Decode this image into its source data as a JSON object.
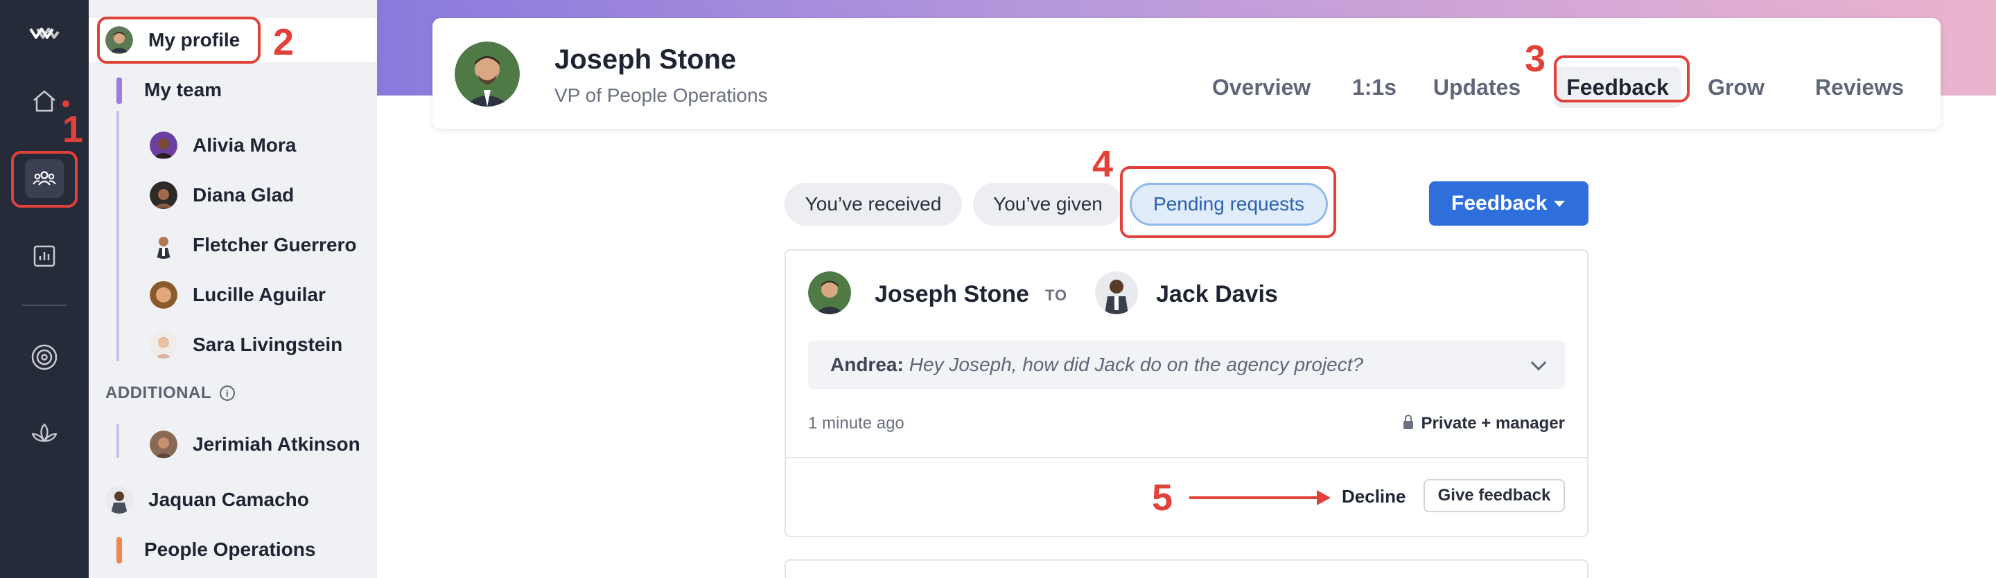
{
  "sidebar": {
    "my_profile": "My profile",
    "my_team": "My team",
    "team_members": [
      "Alivia Mora",
      "Diana Glad",
      "Fletcher Guerrero",
      "Lucille Aguilar",
      "Sara Livingstein"
    ],
    "additional_label": "ADDITIONAL",
    "additional_members": [
      "Jerimiah Atkinson"
    ],
    "other_people": [
      "Jaquan Camacho"
    ],
    "group": "People Operations"
  },
  "header": {
    "name": "Joseph Stone",
    "role": "VP of People Operations",
    "tabs": [
      "Overview",
      "1:1s",
      "Updates",
      "Feedback",
      "Grow",
      "Reviews"
    ],
    "active_tab": "Feedback"
  },
  "filters": {
    "chips": [
      "You’ve received",
      "You’ve given",
      "Pending requests"
    ],
    "selected": "Pending requests",
    "feedback_button": "Feedback"
  },
  "feedback_card": {
    "from": "Joseph Stone",
    "to_label": "TO",
    "to": "Jack Davis",
    "requester": "Andrea:",
    "question": "Hey Joseph, how did Jack do on the agency project?",
    "time": "1 minute ago",
    "privacy": "Private + manager",
    "decline": "Decline",
    "give_feedback": "Give feedback"
  },
  "annotations": [
    "1",
    "2",
    "3",
    "4",
    "5"
  ],
  "colors": {
    "annotation": "#e2413a",
    "primary": "#2e6fdb",
    "rail": "#262b3a"
  },
  "icons": [
    "app-logo-icon",
    "home-icon",
    "people-icon",
    "chart-icon",
    "target-icon",
    "lotus-icon",
    "info-icon",
    "lock-icon",
    "chevron-down-icon",
    "caret-down-icon"
  ]
}
